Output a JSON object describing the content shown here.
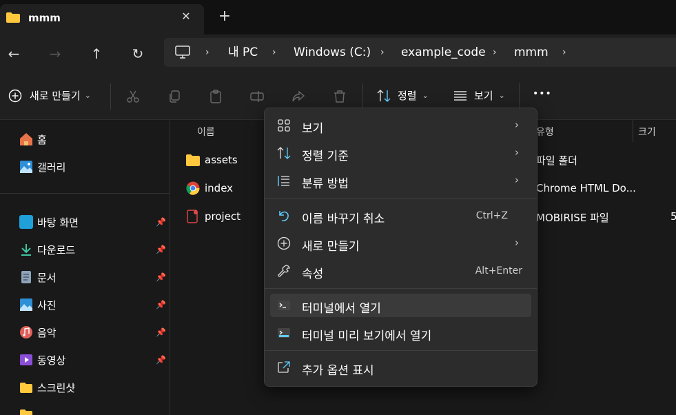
{
  "tab": {
    "title": "mmm",
    "close": "✕",
    "new": "+"
  },
  "nav": {
    "back": "←",
    "forward": "→",
    "up": "↑",
    "refresh": "↻"
  },
  "breadcrumb": [
    "내 PC",
    "Windows (C:)",
    "example_code",
    "mmm"
  ],
  "toolbar": {
    "new_label": "새로 만들기",
    "sort_label": "정렬",
    "view_label": "보기",
    "more": "•••"
  },
  "sidebar": {
    "top": [
      {
        "label": "홈",
        "icon": "home-icon"
      },
      {
        "label": "갤러리",
        "icon": "gallery-icon"
      }
    ],
    "pinned": [
      {
        "label": "바탕 화면",
        "icon": "desktop-icon"
      },
      {
        "label": "다운로드",
        "icon": "download-icon"
      },
      {
        "label": "문서",
        "icon": "documents-icon"
      },
      {
        "label": "사진",
        "icon": "pictures-icon"
      },
      {
        "label": "음악",
        "icon": "music-icon"
      },
      {
        "label": "동영상",
        "icon": "videos-icon"
      },
      {
        "label": "스크린샷",
        "icon": "folder-icon"
      }
    ]
  },
  "columns": {
    "name": "이름",
    "type": "유형",
    "size": "크기"
  },
  "files": [
    {
      "name": "assets",
      "type": "파일 폴더",
      "size": ""
    },
    {
      "name": "index",
      "type": "Chrome HTML Do...",
      "size": ""
    },
    {
      "name": "project",
      "type": "MOBIRISE 파일",
      "size": "5"
    }
  ],
  "context_menu": {
    "view": "보기",
    "sort_by": "정렬 기준",
    "group_by": "분류 방법",
    "undo_rename": "이름 바꾸기 취소",
    "undo_shortcut": "Ctrl+Z",
    "new": "새로 만들기",
    "properties": "속성",
    "properties_shortcut": "Alt+Enter",
    "open_terminal": "터미널에서 열기",
    "open_terminal_preview": "터미널 미리 보기에서 열기",
    "more_options": "추가 옵션 표시"
  },
  "colors": {
    "accent": "#60cdff",
    "folder": "#ffc83d",
    "menu_bg": "#2c2c2c",
    "highlight": "#3a3a3a"
  }
}
